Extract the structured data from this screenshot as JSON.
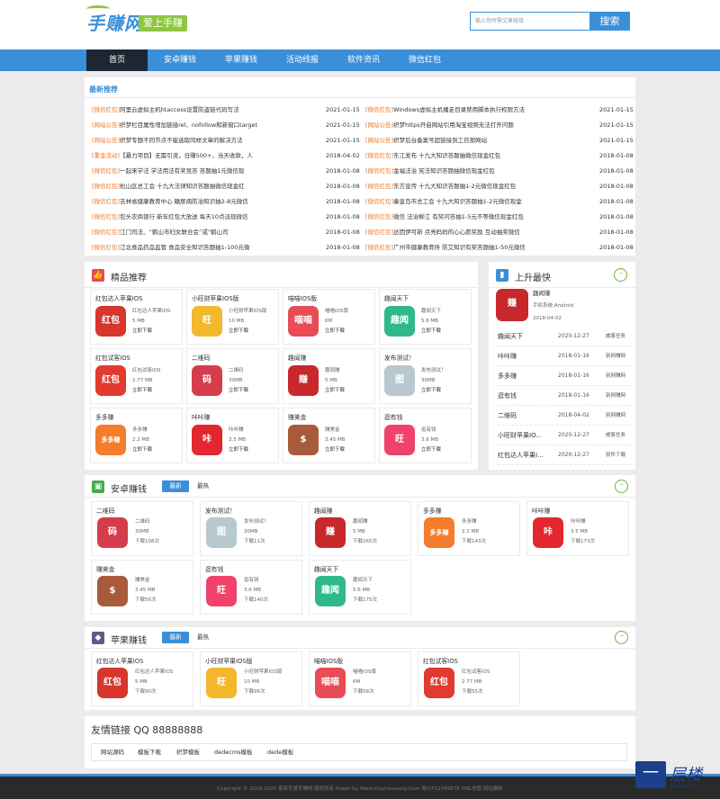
{
  "header": {
    "logo_text": "手赚网",
    "slogan": "爱上手赚",
    "search_placeholder": "输入你所需文章链接",
    "search_button": "搜索"
  },
  "nav": [
    {
      "label": "首页",
      "active": true
    },
    {
      "label": "安卓赚钱",
      "active": false
    },
    {
      "label": "苹果赚钱",
      "active": false
    },
    {
      "label": "活动线报",
      "active": false
    },
    {
      "label": "软件资讯",
      "active": false
    },
    {
      "label": "微信红包",
      "active": false
    }
  ],
  "latest": {
    "title": "最新推荐",
    "left": [
      {
        "tag": "[微信红包]",
        "text": "阿里云虚拟主机htaccess设置防盗链代码写法",
        "date": "2021-01-15"
      },
      {
        "tag": "[网站公告]",
        "text": "织梦栏目属性增加链接rel、nofollow和新窗口target",
        "date": "2021-01-15"
      },
      {
        "tag": "[网站公告]",
        "text": "织梦专题不同节点不能选取同样文章的解决方法",
        "date": "2021-01-15"
      },
      {
        "tag": "[重金活动]",
        "text": "【暴力项目】无需引流，日赚500+，当天收款，人",
        "date": "2018-04-02"
      },
      {
        "tag": "[微信红包]",
        "text": "一起来学法 学法用法有奖竞答 答题抽1元微信现",
        "date": "2018-01-08"
      },
      {
        "tag": "[微信红包]",
        "text": "松山区总工会 十九大法律知识答题抽微信现金红",
        "date": "2018-01-08"
      },
      {
        "tag": "[微信红包]",
        "text": "吉林省健康教育中心 糖尿病防治知识抽2-8元微信",
        "date": "2018-01-08"
      },
      {
        "tag": "[微信红包]",
        "text": "包头农商银行 新年红包大放送 每天10点派现微信",
        "date": "2018-01-08"
      },
      {
        "tag": "[微信红包]",
        "text": "江门司法、“鹤山市妇女联合会”或“鹤山司",
        "date": "2018-01-08"
      },
      {
        "tag": "[微信红包]",
        "text": "江北食品药品监管 食品安全知识答题抽1-100元微",
        "date": "2018-01-08"
      }
    ],
    "right": [
      {
        "tag": "[微信红包]",
        "text": "Windows虚拟主机播走目录禁用脚本执行权限方法",
        "date": "2021-01-15"
      },
      {
        "tag": "[网站公告]",
        "text": "织梦https开启网站引用淘宝视频无法打开问题",
        "date": "2021-01-15"
      },
      {
        "tag": "[网站公告]",
        "text": "织梦后台备案号超链接到工信部网站",
        "date": "2021-01-15"
      },
      {
        "tag": "[微信红包]",
        "text": "东江发布 十九大知识答题抽微信现金红包",
        "date": "2018-01-08"
      },
      {
        "tag": "[微信红包]",
        "text": "金福法治 宪法知识答题抽微信现金红包",
        "date": "2018-01-08"
      },
      {
        "tag": "[微信红包]",
        "text": "东方宣传 十九大知识答题抽1-2元微信现金红包",
        "date": "2018-01-08"
      },
      {
        "tag": "[微信红包]",
        "text": "秦皇岛市总工会 十九大知识答题抽1-2元微信现金",
        "date": "2018-01-08"
      },
      {
        "tag": "[微信红包]",
        "text": "微信 法治柳江 有奖问答抽1-5元不等微信现金红包",
        "date": "2018-01-08"
      },
      {
        "tag": "[微信红包]",
        "text": "达因伊可新 点亮妈妈的心心愿奖励 互动抽奖微信",
        "date": "2018-01-08"
      },
      {
        "tag": "[微信红包]",
        "text": "广州市健康教育所 防艾知识有奖答题抽1-50元微信",
        "date": "2018-01-08"
      }
    ]
  },
  "featured": {
    "title": "精品推荐",
    "download_label": "立即下载",
    "apps": [
      {
        "name": "红包达人苹果IOS",
        "short": "红包达人苹果IOS",
        "size": "5 MB",
        "icon_text": "红包",
        "color": "#d8362c"
      },
      {
        "name": "小旺财苹果IOS版",
        "short": "小旺财苹果IOS版",
        "size": "10 MB",
        "icon_text": "旺",
        "color": "#f3b72b"
      },
      {
        "name": "喵喵IOS版",
        "short": "喵喵IOS版",
        "size": "6M",
        "icon_text": "喵喵",
        "color": "#e94c55"
      },
      {
        "name": "趣闻天下",
        "short": "趣闻天下",
        "size": "5.6 MB",
        "icon_text": "趣闻",
        "color": "#2fb98a"
      },
      {
        "name": "红包试客IOS",
        "short": "红包试客IOS",
        "size": "2.77 MB",
        "icon_text": "红包",
        "color": "#e23a2e"
      },
      {
        "name": "二维码",
        "short": "二维码",
        "size": "30MB",
        "icon_text": "码",
        "color": "#d63d4c"
      },
      {
        "name": "趣闻赚",
        "short": "趣闻赚",
        "size": "5 MB",
        "icon_text": "赚",
        "color": "#c8282c"
      },
      {
        "name": "发布测试！",
        "short": "发布测试！",
        "size": "30MB",
        "icon_text": "图",
        "color": "#b7c9cf"
      },
      {
        "name": "多多赚",
        "short": "多多赚",
        "size": "2.2 MB",
        "icon_text": "多多赚",
        "color": "#f57c2a"
      },
      {
        "name": "咔咔赚",
        "short": "咔咔赚",
        "size": "3.5 MB",
        "icon_text": "咔",
        "color": "#e3262f"
      },
      {
        "name": "赚美金",
        "short": "赚美金",
        "size": "3.45 MB",
        "icon_text": "$",
        "color": "#a85b3a"
      },
      {
        "name": "逛有钱",
        "short": "逛有钱",
        "size": "3.6 MB",
        "icon_text": "旺",
        "color": "#f0426a"
      }
    ]
  },
  "rising": {
    "title": "上升最快",
    "top": {
      "name": "趣闻赚",
      "platform": "手机系统:Android",
      "date": "2018-04-02",
      "icon_text": "赚",
      "color": "#c8282c"
    },
    "list": [
      {
        "name": "趣闻天下",
        "date": "2020-12-27",
        "cat": "威客任务"
      },
      {
        "name": "咔咔赚",
        "date": "2018-01-16",
        "cat": "别网赚网"
      },
      {
        "name": "多多赚",
        "date": "2018-01-16",
        "cat": "别网赚网"
      },
      {
        "name": "逛有钱",
        "date": "2018-01-16",
        "cat": "别网赚网"
      },
      {
        "name": "二维码",
        "date": "2018-04-02",
        "cat": "别网赚网"
      },
      {
        "name": "小旺财苹果IO...",
        "date": "2020-12-27",
        "cat": "威客任务"
      },
      {
        "name": "红包达人苹果I...",
        "date": "2020-12-27",
        "cat": "软件下载"
      }
    ]
  },
  "android": {
    "title": "安卓赚钱",
    "tab_new": "最新",
    "tab_hot": "最热",
    "apps": [
      {
        "name": "二维码",
        "short": "二维码",
        "size": "30MB",
        "dl": "下载108次",
        "icon_text": "码",
        "color": "#d63d4c"
      },
      {
        "name": "发布测试！",
        "short": "发布测试！",
        "size": "30MB",
        "dl": "下载11次",
        "icon_text": "图",
        "color": "#b7c9cf"
      },
      {
        "name": "趣闻赚",
        "short": "趣闻赚",
        "size": "5 MB",
        "dl": "下载265次",
        "icon_text": "赚",
        "color": "#c8282c"
      },
      {
        "name": "多多赚",
        "short": "多多赚",
        "size": "2.2 MB",
        "dl": "下载143次",
        "icon_text": "多多赚",
        "color": "#f57c2a"
      },
      {
        "name": "咔咔赚",
        "short": "咔咔赚",
        "size": "3.5 MB",
        "dl": "下载173次",
        "icon_text": "咔",
        "color": "#e3262f"
      },
      {
        "name": "赚美金",
        "short": "赚美金",
        "size": "3.45 MB",
        "dl": "下载56次",
        "icon_text": "$",
        "color": "#a85b3a"
      },
      {
        "name": "逛有钱",
        "short": "逛有钱",
        "size": "3.6 MB",
        "dl": "下载140次",
        "icon_text": "旺",
        "color": "#f0426a"
      },
      {
        "name": "趣闻天下",
        "short": "趣闻天下",
        "size": "5.6 MB",
        "dl": "下载175次",
        "icon_text": "趣闻",
        "color": "#2fb98a"
      }
    ]
  },
  "ios": {
    "title": "苹果赚钱",
    "tab_new": "最新",
    "tab_hot": "最热",
    "apps": [
      {
        "name": "红包达人苹果IOS",
        "short": "红包达人苹果IOS",
        "size": "5 MB",
        "dl": "下载90次",
        "icon_text": "红包",
        "color": "#d8362c"
      },
      {
        "name": "小旺财苹果IOS版",
        "short": "小旺财苹果IOS版",
        "size": "10 MB",
        "dl": "下载96次",
        "icon_text": "旺",
        "color": "#f3b72b"
      },
      {
        "name": "喵喵IOS版",
        "short": "喵喵IOS版",
        "size": "6M",
        "dl": "下载58次",
        "icon_text": "喵喵",
        "color": "#e94c55"
      },
      {
        "name": "红包试客IOS",
        "short": "红包试客IOS",
        "size": "2.77 MB",
        "dl": "下载55次",
        "icon_text": "红包",
        "color": "#e23a2e"
      }
    ]
  },
  "friends": {
    "title": "友情链接 QQ 88888888",
    "links": [
      "网站源码",
      "模板下载",
      "织梦模板",
      "dedecms模板",
      "dede模板"
    ]
  },
  "footer": {
    "text": "Copyright © 2018-2020 某某手游手赚网 版权所有 Power by Www.Xiuzhanwang.Com 粤ICP12345678 XML地图 网站模板"
  },
  "watermark": {
    "box": "一",
    "text": "层楼",
    "sub": "cenglouba.com"
  },
  "colors": {
    "primary": "#3b8fd8",
    "accent": "#8dc73f",
    "tag": "#e8792b",
    "dark_nav": "#1c2733"
  }
}
